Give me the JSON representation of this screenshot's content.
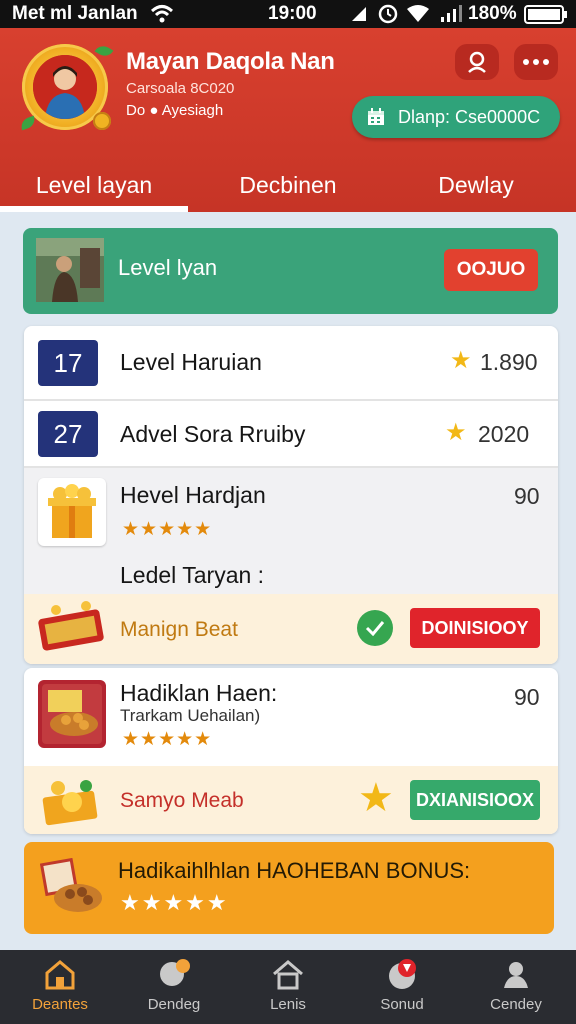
{
  "status_bar": {
    "left": "Met ml Janlan",
    "time": "19:00",
    "battery": "180%"
  },
  "header": {
    "user_name": "Mayan Daqola Nan",
    "sub1": "Carsoala 8C020",
    "sub2": "Do ● Ayesiagh",
    "balance": "Dlanp: Cse0000C"
  },
  "tabs": [
    {
      "label": "Level layan",
      "active": true
    },
    {
      "label": "Decbinen",
      "active": false
    },
    {
      "label": "Dewlay",
      "active": false
    }
  ],
  "featured": {
    "label": "Level lyan",
    "button": "OOJUO"
  },
  "rows": [
    {
      "rank": "17",
      "title": "Level Haruian",
      "score": "1.890"
    },
    {
      "rank": "27",
      "title": "Advel Sora Rruiby",
      "score": "2020"
    }
  ],
  "item1": {
    "title": "Hevel Hardjan",
    "score": "90",
    "stars": "★★★★★"
  },
  "section_title": "Ledel Taryan :",
  "reward1": {
    "label": "Manign Beat",
    "button": "DOINISIOOY"
  },
  "item2": {
    "title": "Hadiklan Haen:",
    "subtitle": "Trarkam Uehailan)",
    "score": "90",
    "stars": "★★★★★"
  },
  "reward2": {
    "label": "Samyo Meab",
    "button": "DXIANISIOOX"
  },
  "bonus": {
    "title": "Hadikaihlhlan HAOHEBAN BONUS:",
    "stars": "★★★★★"
  },
  "nav": [
    {
      "label": "Deantes",
      "icon": "home-icon",
      "active": true
    },
    {
      "label": "Dendeg",
      "icon": "chat-icon",
      "active": false
    },
    {
      "label": "Lenis",
      "icon": "house-icon",
      "active": false
    },
    {
      "label": "Sonud",
      "icon": "trophy-icon",
      "active": false
    },
    {
      "label": "Cendey",
      "icon": "profile-icon",
      "active": false
    }
  ],
  "colors": {
    "header": "#c63426",
    "accent_green": "#3aa37a",
    "accent_red": "#e2412f",
    "bonus": "#f4a01e",
    "nav_bg": "#2a2c31"
  }
}
